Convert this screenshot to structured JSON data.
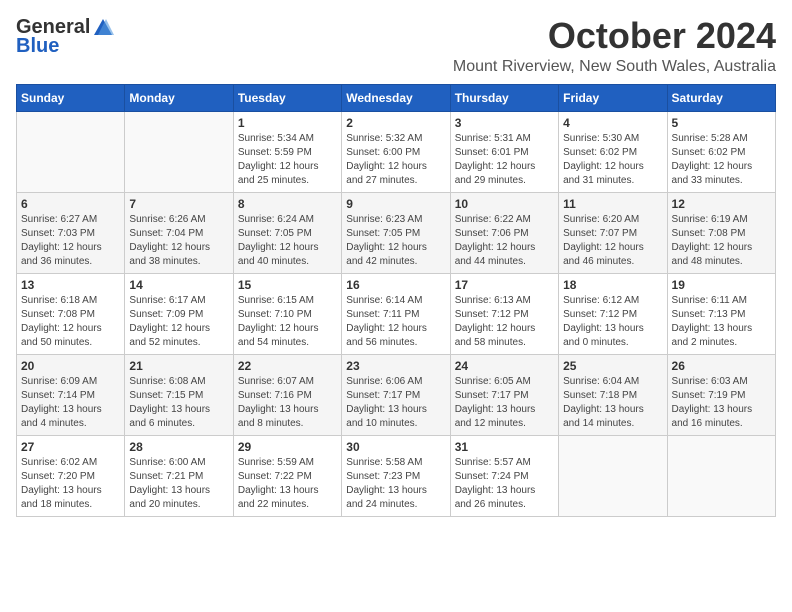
{
  "header": {
    "logo_general": "General",
    "logo_blue": "Blue",
    "month": "October 2024",
    "location": "Mount Riverview, New South Wales, Australia"
  },
  "weekdays": [
    "Sunday",
    "Monday",
    "Tuesday",
    "Wednesday",
    "Thursday",
    "Friday",
    "Saturday"
  ],
  "weeks": [
    [
      {
        "day": "",
        "sunrise": "",
        "sunset": "",
        "daylight": ""
      },
      {
        "day": "",
        "sunrise": "",
        "sunset": "",
        "daylight": ""
      },
      {
        "day": "1",
        "sunrise": "Sunrise: 5:34 AM",
        "sunset": "Sunset: 5:59 PM",
        "daylight": "Daylight: 12 hours and 25 minutes."
      },
      {
        "day": "2",
        "sunrise": "Sunrise: 5:32 AM",
        "sunset": "Sunset: 6:00 PM",
        "daylight": "Daylight: 12 hours and 27 minutes."
      },
      {
        "day": "3",
        "sunrise": "Sunrise: 5:31 AM",
        "sunset": "Sunset: 6:01 PM",
        "daylight": "Daylight: 12 hours and 29 minutes."
      },
      {
        "day": "4",
        "sunrise": "Sunrise: 5:30 AM",
        "sunset": "Sunset: 6:02 PM",
        "daylight": "Daylight: 12 hours and 31 minutes."
      },
      {
        "day": "5",
        "sunrise": "Sunrise: 5:28 AM",
        "sunset": "Sunset: 6:02 PM",
        "daylight": "Daylight: 12 hours and 33 minutes."
      }
    ],
    [
      {
        "day": "6",
        "sunrise": "Sunrise: 6:27 AM",
        "sunset": "Sunset: 7:03 PM",
        "daylight": "Daylight: 12 hours and 36 minutes."
      },
      {
        "day": "7",
        "sunrise": "Sunrise: 6:26 AM",
        "sunset": "Sunset: 7:04 PM",
        "daylight": "Daylight: 12 hours and 38 minutes."
      },
      {
        "day": "8",
        "sunrise": "Sunrise: 6:24 AM",
        "sunset": "Sunset: 7:05 PM",
        "daylight": "Daylight: 12 hours and 40 minutes."
      },
      {
        "day": "9",
        "sunrise": "Sunrise: 6:23 AM",
        "sunset": "Sunset: 7:05 PM",
        "daylight": "Daylight: 12 hours and 42 minutes."
      },
      {
        "day": "10",
        "sunrise": "Sunrise: 6:22 AM",
        "sunset": "Sunset: 7:06 PM",
        "daylight": "Daylight: 12 hours and 44 minutes."
      },
      {
        "day": "11",
        "sunrise": "Sunrise: 6:20 AM",
        "sunset": "Sunset: 7:07 PM",
        "daylight": "Daylight: 12 hours and 46 minutes."
      },
      {
        "day": "12",
        "sunrise": "Sunrise: 6:19 AM",
        "sunset": "Sunset: 7:08 PM",
        "daylight": "Daylight: 12 hours and 48 minutes."
      }
    ],
    [
      {
        "day": "13",
        "sunrise": "Sunrise: 6:18 AM",
        "sunset": "Sunset: 7:08 PM",
        "daylight": "Daylight: 12 hours and 50 minutes."
      },
      {
        "day": "14",
        "sunrise": "Sunrise: 6:17 AM",
        "sunset": "Sunset: 7:09 PM",
        "daylight": "Daylight: 12 hours and 52 minutes."
      },
      {
        "day": "15",
        "sunrise": "Sunrise: 6:15 AM",
        "sunset": "Sunset: 7:10 PM",
        "daylight": "Daylight: 12 hours and 54 minutes."
      },
      {
        "day": "16",
        "sunrise": "Sunrise: 6:14 AM",
        "sunset": "Sunset: 7:11 PM",
        "daylight": "Daylight: 12 hours and 56 minutes."
      },
      {
        "day": "17",
        "sunrise": "Sunrise: 6:13 AM",
        "sunset": "Sunset: 7:12 PM",
        "daylight": "Daylight: 12 hours and 58 minutes."
      },
      {
        "day": "18",
        "sunrise": "Sunrise: 6:12 AM",
        "sunset": "Sunset: 7:12 PM",
        "daylight": "Daylight: 13 hours and 0 minutes."
      },
      {
        "day": "19",
        "sunrise": "Sunrise: 6:11 AM",
        "sunset": "Sunset: 7:13 PM",
        "daylight": "Daylight: 13 hours and 2 minutes."
      }
    ],
    [
      {
        "day": "20",
        "sunrise": "Sunrise: 6:09 AM",
        "sunset": "Sunset: 7:14 PM",
        "daylight": "Daylight: 13 hours and 4 minutes."
      },
      {
        "day": "21",
        "sunrise": "Sunrise: 6:08 AM",
        "sunset": "Sunset: 7:15 PM",
        "daylight": "Daylight: 13 hours and 6 minutes."
      },
      {
        "day": "22",
        "sunrise": "Sunrise: 6:07 AM",
        "sunset": "Sunset: 7:16 PM",
        "daylight": "Daylight: 13 hours and 8 minutes."
      },
      {
        "day": "23",
        "sunrise": "Sunrise: 6:06 AM",
        "sunset": "Sunset: 7:17 PM",
        "daylight": "Daylight: 13 hours and 10 minutes."
      },
      {
        "day": "24",
        "sunrise": "Sunrise: 6:05 AM",
        "sunset": "Sunset: 7:17 PM",
        "daylight": "Daylight: 13 hours and 12 minutes."
      },
      {
        "day": "25",
        "sunrise": "Sunrise: 6:04 AM",
        "sunset": "Sunset: 7:18 PM",
        "daylight": "Daylight: 13 hours and 14 minutes."
      },
      {
        "day": "26",
        "sunrise": "Sunrise: 6:03 AM",
        "sunset": "Sunset: 7:19 PM",
        "daylight": "Daylight: 13 hours and 16 minutes."
      }
    ],
    [
      {
        "day": "27",
        "sunrise": "Sunrise: 6:02 AM",
        "sunset": "Sunset: 7:20 PM",
        "daylight": "Daylight: 13 hours and 18 minutes."
      },
      {
        "day": "28",
        "sunrise": "Sunrise: 6:00 AM",
        "sunset": "Sunset: 7:21 PM",
        "daylight": "Daylight: 13 hours and 20 minutes."
      },
      {
        "day": "29",
        "sunrise": "Sunrise: 5:59 AM",
        "sunset": "Sunset: 7:22 PM",
        "daylight": "Daylight: 13 hours and 22 minutes."
      },
      {
        "day": "30",
        "sunrise": "Sunrise: 5:58 AM",
        "sunset": "Sunset: 7:23 PM",
        "daylight": "Daylight: 13 hours and 24 minutes."
      },
      {
        "day": "31",
        "sunrise": "Sunrise: 5:57 AM",
        "sunset": "Sunset: 7:24 PM",
        "daylight": "Daylight: 13 hours and 26 minutes."
      },
      {
        "day": "",
        "sunrise": "",
        "sunset": "",
        "daylight": ""
      },
      {
        "day": "",
        "sunrise": "",
        "sunset": "",
        "daylight": ""
      }
    ]
  ]
}
